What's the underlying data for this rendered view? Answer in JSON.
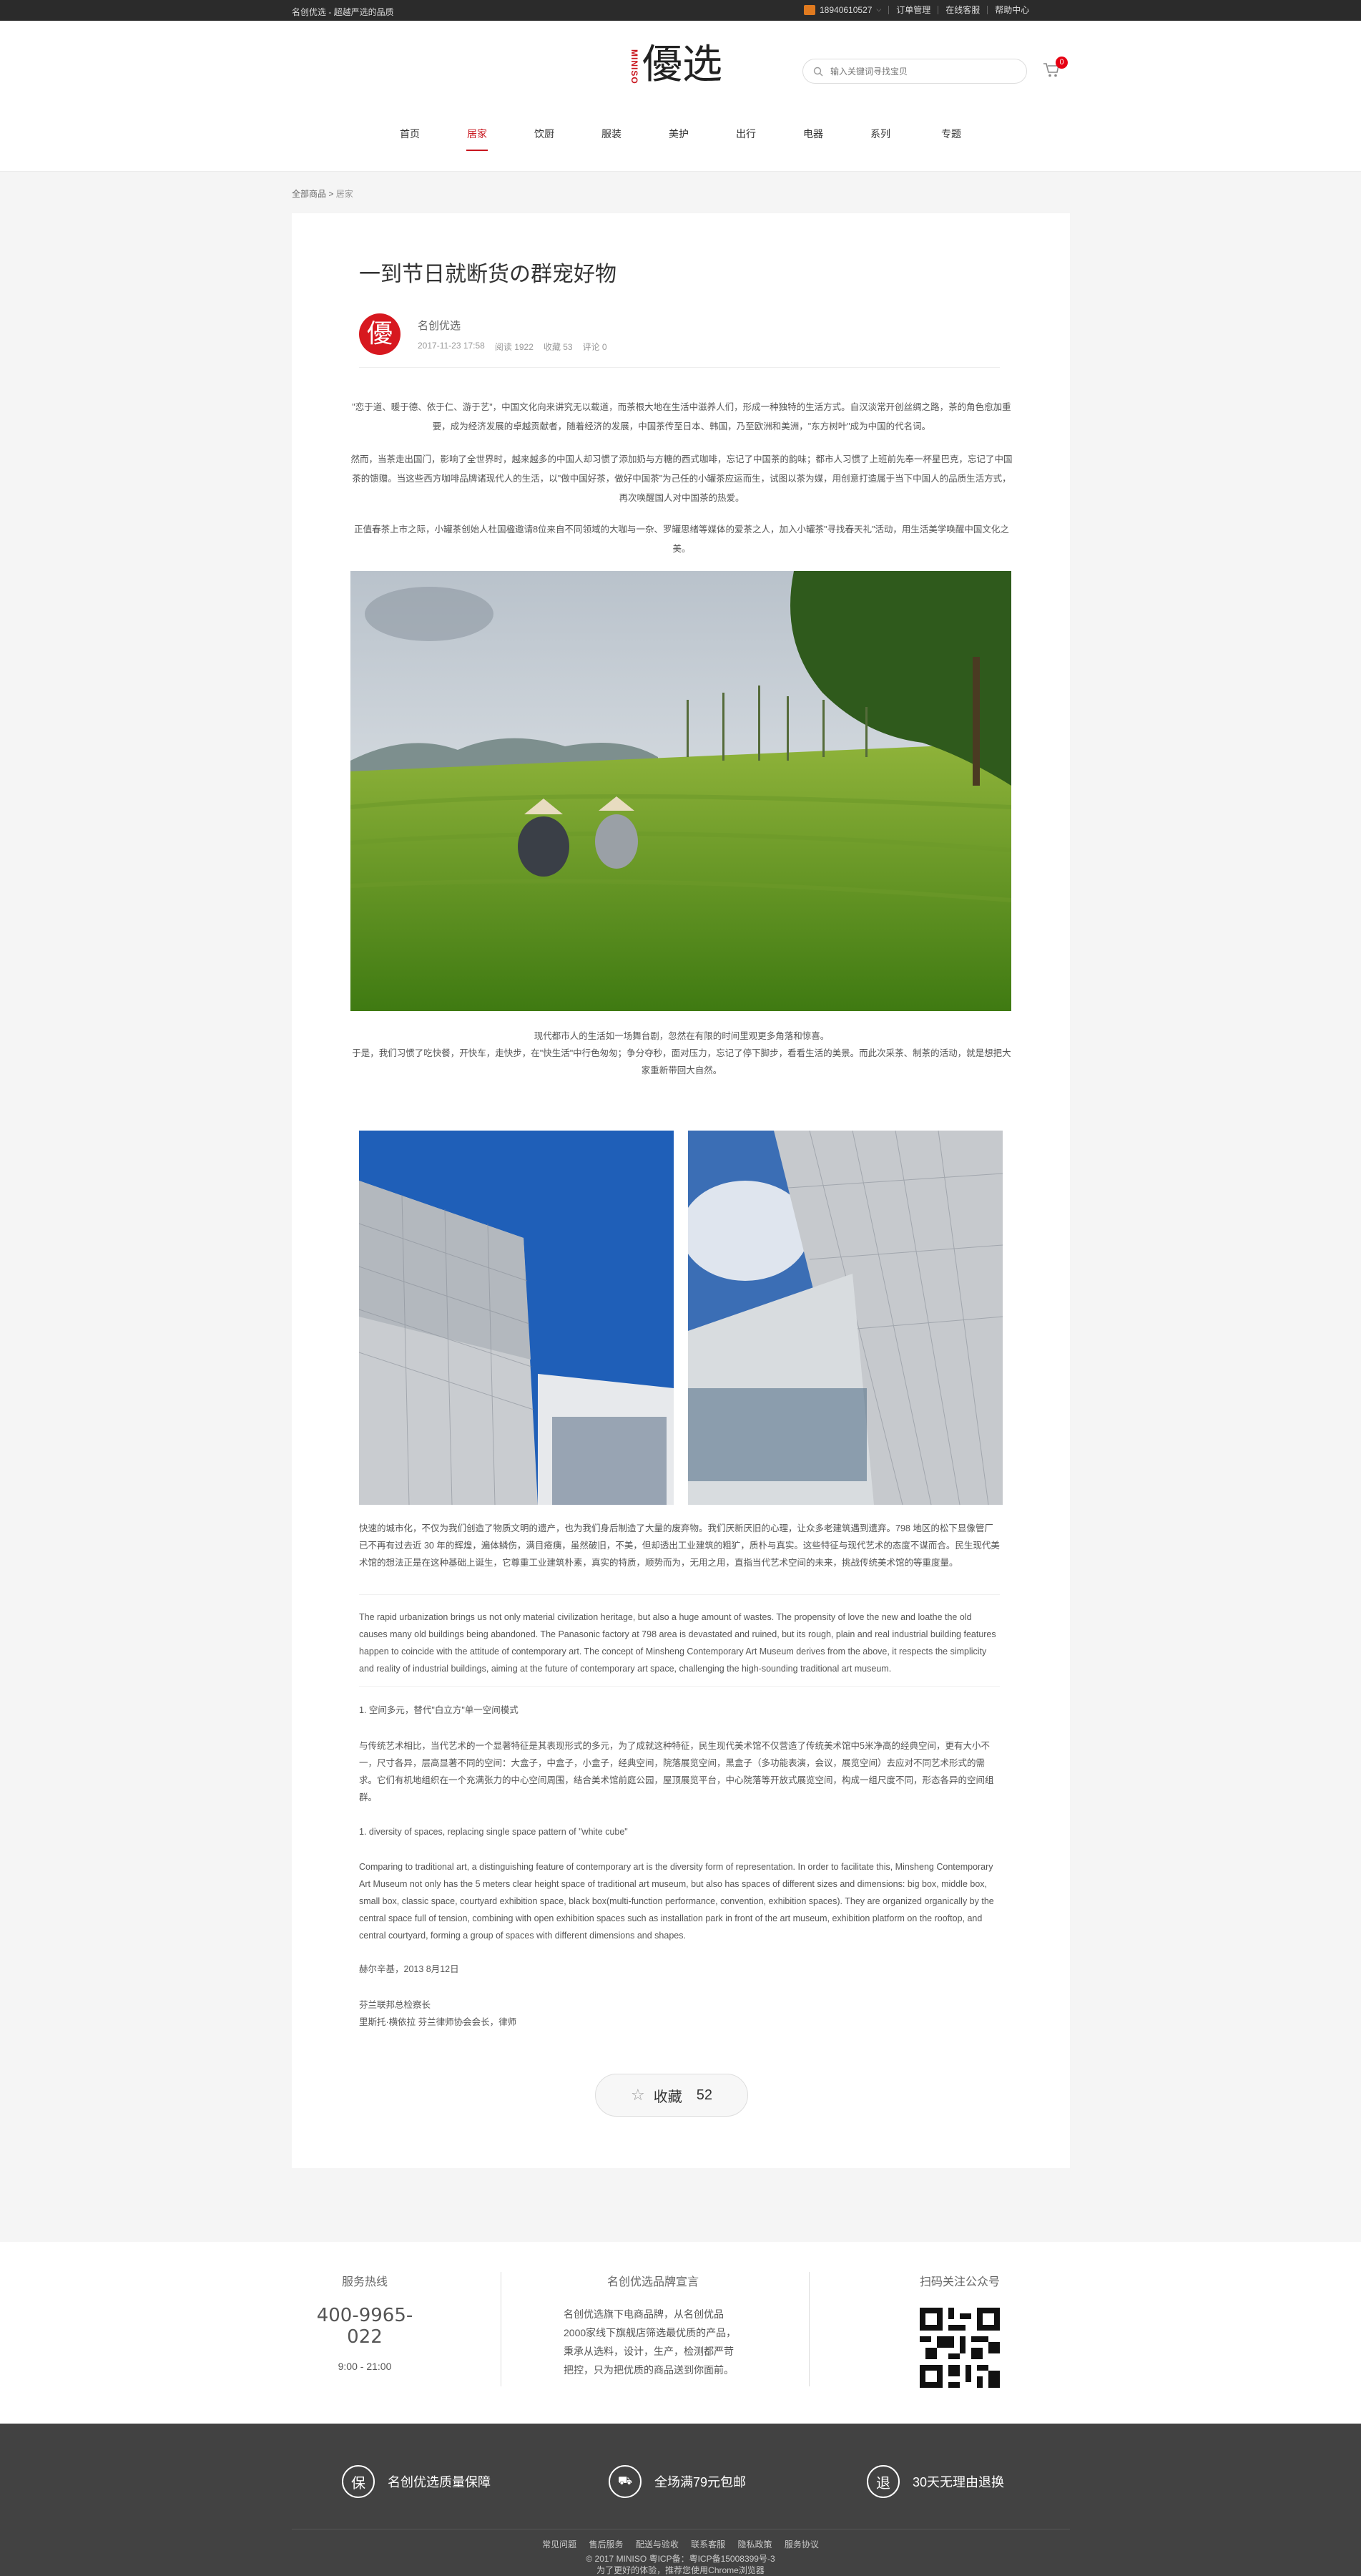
{
  "topbar": {
    "slogan": "名创优选 - 超越严选的品质",
    "phone": "18940610527",
    "orders": "订单管理",
    "online_service": "在线客服",
    "help": "帮助中心"
  },
  "header": {
    "logo_en": "MINISO",
    "logo_cn": "優选",
    "search_placeholder": "输入关键词寻找宝贝",
    "cart_count": "0"
  },
  "nav": [
    "首页",
    "居家",
    "饮厨",
    "服装",
    "美护",
    "出行",
    "电器",
    "系列",
    "专题"
  ],
  "nav_active_index": 1,
  "breadcrumb": {
    "root": "全部商品",
    "sep": ">",
    "current": "居家"
  },
  "article": {
    "title": "一到节日就断货の群宠好物",
    "author_avatar": "優",
    "author": "名创优选",
    "date": "2017-11-23 17:58",
    "views": "阅读 1922",
    "favorites": "收藏 53",
    "comments": "评论 0",
    "intro": [
      "\"恋于道、暖于德、依于仁、游于艺\"，中国文化向来讲究无以载道，而茶根大地在生活中滋养人们，形成一种独特的生活方式。自汉淡常开创丝绸之路，茶的角色愈加重要，成为经济发展的卓越贡献者，随着经济的发展，中国茶传至日本、韩国，乃至欧洲和美洲，\"东方树叶\"成为中国的代名词。",
      "然而，当茶走出国门，影响了全世界时，越来越多的中国人却习惯了添加奶与方糖的西式咖啡，忘记了中国茶的韵味；都市人习惯了上班前先奉一杯星巴克，忘记了中国茶的馈赠。当这些西方咖啡品牌诸现代人的生活，以\"做中国好茶，做好中国茶\"为己任的小罐茶应运而生，试图以茶为媒，用创意打造属于当下中国人的品质生活方式，再次唤醒国人对中国茶的热爱。",
      "正值春茶上市之际，小罐茶创始人杜国楹邀请8位来自不同领域的大咖与一杂、罗罐思绪等媒体的爱茶之人，加入小罐茶\"寻找春天礼\"活动，用生活美学唤醒中国文化之美。"
    ],
    "photo_caption": [
      "现代都市人的生活如一场舞台剧，忽然在有限的时间里观更多角落和惊喜。",
      "于是，我们习惯了吃快餐，开快车，走快步，在\"快生活\"中行色匆匆；争分夺秒，面对压力，忘记了停下脚步，看看生活的美景。而此次采茶、制茶的活动，就是想把大家重新带回大自然。"
    ],
    "para_cn_1": "快速的城市化，不仅为我们创造了物质文明的遗产，也为我们身后制造了大量的废弃物。我们厌新厌旧的心理，让众多老建筑遇到遗弃。798 地区的松下显像管厂已不再有过去近 30 年的辉煌，遍体鳞伤，满目疮痍，虽然破旧，不美，但却透出工业建筑的粗犷，质朴与真实。这些特征与现代艺术的态度不谋而合。民生现代美术馆的想法正是在这种基础上诞生，它尊重工业建筑朴素，真实的特质，顺势而为，无用之用，直指当代艺术空间的未来，挑战传统美术馆的等重度量。",
    "para_en_1": "The rapid urbanization brings us not only material civilization heritage, but also a huge amount of wastes. The propensity of love the new and loathe the old causes many old buildings being abandoned. The Panasonic factory at 798 area is devastated and ruined, but its rough, plain and real industrial building features happen to coincide with the attitude of contemporary art. The concept of Minsheng Contemporary Art Museum derives from the above, it respects the simplicity and reality of industrial buildings, aiming at the future of contemporary art space, challenging the high-sounding traditional art museum.",
    "heading_cn": "1. 空间多元，替代\"白立方\"单一空间模式",
    "para_cn_2": "与传统艺术相比，当代艺术的一个显著特征是其表现形式的多元，为了成就这种特征，民生现代美术馆不仅营造了传统美术馆中5米净高的经典空间，更有大小不一，尺寸各异，层高显著不同的空间：大盒子，中盒子，小盒子，经典空间，院落展览空间，黑盒子（多功能表演，会议，展览空间）去应对不同艺术形式的需求。它们有机地组织在一个充满张力的中心空间周围，结合美术馆前庭公园，屋顶展览平台，中心院落等开放式展览空间，构成一组尺度不同，形态各异的空间组群。",
    "heading_en": "1. diversity of spaces, replacing single space pattern of \"white cube\"",
    "para_en_2": "Comparing to traditional art, a distinguishing feature of contemporary art is the diversity form of representation. In order to facilitate this, Minsheng Contemporary Art Museum not only has the 5 meters clear height space of traditional art museum, but also has spaces of different sizes and dimensions: big box, middle box, small box, classic space, courtyard exhibition space, black box(multi-function performance, convention, exhibition spaces). They are organized organically by the central space full of tension, combining with open exhibition spaces such as installation park in front of the art museum, exhibition platform on the rooftop, and central courtyard, forming a group of spaces with different dimensions and shapes.",
    "signature_date": "赫尔辛基，2013 8月12日",
    "signature_title": "芬兰联邦总检察长",
    "signature_names": "里斯托·横依拉    芬兰律师协会会长，律师",
    "fav_label": "收藏",
    "fav_count": "52"
  },
  "service": {
    "hotline_title": "服务热线",
    "hotline": "400-9965-022",
    "hours": "9:00 - 21:00",
    "brand_title": "名创优选品牌宣言",
    "brand_text": "名创优选旗下电商品牌，从名创优品2000家线下旗舰店筛选最优质的产品，秉承从选料，设计，生产，检测都严苛把控，只为把优质的商品送到你面前。",
    "qr_title": "扫码关注公众号"
  },
  "footer": {
    "guarantees": [
      {
        "icon": "保",
        "label": "名创优选质量保障"
      },
      {
        "icon": "🚚",
        "label": "全场满79元包邮"
      },
      {
        "icon": "退",
        "label": "30天无理由退换"
      }
    ],
    "links": [
      "常见问题",
      "售后服务",
      "配送与验收",
      "联系客服",
      "隐私政策",
      "服务协议"
    ],
    "copyright": "© 2017 MINISO         粤ICP备：粤ICP备15008399号-3",
    "browser_note": "为了更好的体验，推荐您使用Chrome浏览器"
  }
}
